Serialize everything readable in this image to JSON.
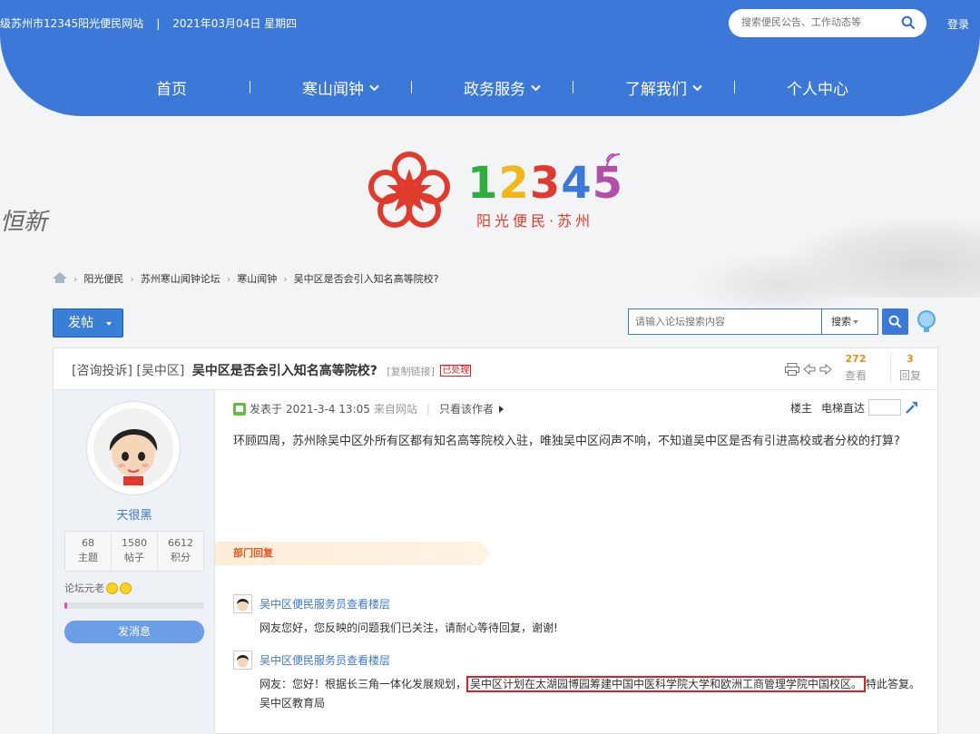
{
  "top": {
    "site": "级苏州市12345阳光便民网站",
    "sep": "|",
    "date": "2021年03月04日 星期四",
    "search_placeholder": "搜索便民公告、工作动态等",
    "login": "登录"
  },
  "nav": {
    "items": [
      "首页",
      "寒山闻钟",
      "政务服务",
      "了解我们",
      "个人中心"
    ]
  },
  "logo": {
    "number": "12345",
    "subtitle": "阳光便民·苏州"
  },
  "background": {
    "calli1": "",
    "calli2": "恒新"
  },
  "breadcrumb": [
    "阳光便民",
    "苏州寒山闻钟论坛",
    "寒山闻钟",
    "吴中区是否会引入知名高等院校?"
  ],
  "toolbar": {
    "post_label": "发帖",
    "forum_search_placeholder": "请输入论坛搜索内容",
    "search_type": "搜索"
  },
  "thread": {
    "category": "[咨询投诉] [吴中区]",
    "subject": "吴中区是否会引入知名高等院校?",
    "copy_link": "[复制链接]",
    "status": "已处理",
    "views": "272",
    "views_label": "查看",
    "replies": "3",
    "replies_label": "回复"
  },
  "author": {
    "name": "天很黑",
    "stats": [
      {
        "value": "68",
        "label": "主题"
      },
      {
        "value": "1580",
        "label": "帖子"
      },
      {
        "value": "6612",
        "label": "积分"
      }
    ],
    "rank": "论坛元老",
    "level_progress": 0.02,
    "message_button": "发消息"
  },
  "post": {
    "posted_prefix": "发表于",
    "posted_time": "2021-3-4 13:05",
    "source": "来自网站",
    "only_author": "只看该作者",
    "floor_label": "楼主",
    "jump_label": "电梯直达",
    "body": "环顾四周，苏州除吴中区外所有区都有知名高等院校入驻，唯独吴中区闷声不响，不知道吴中区是否有引进高校或者分校的打算?"
  },
  "dept_reply": {
    "tag": "部门回复",
    "replies": [
      {
        "who": "吴中区便民服务员查看楼层",
        "text": "网友您好，您反映的问题我们已关注，请耐心等待回复，谢谢!"
      },
      {
        "who": "吴中区便民服务员查看楼层",
        "text_before": "网友：您好！根据长三角一体化发展规划，",
        "text_highlight": "吴中区计划在太湖园博园筹建中国中医科学院大学和欧洲工商管理学院中国校区。",
        "text_after": "特此答复。吴中区教育局"
      }
    ]
  },
  "colors": {
    "brand_blue": "#3b78d8",
    "status_red": "#e02020",
    "stat_orange": "#f08a1b"
  }
}
